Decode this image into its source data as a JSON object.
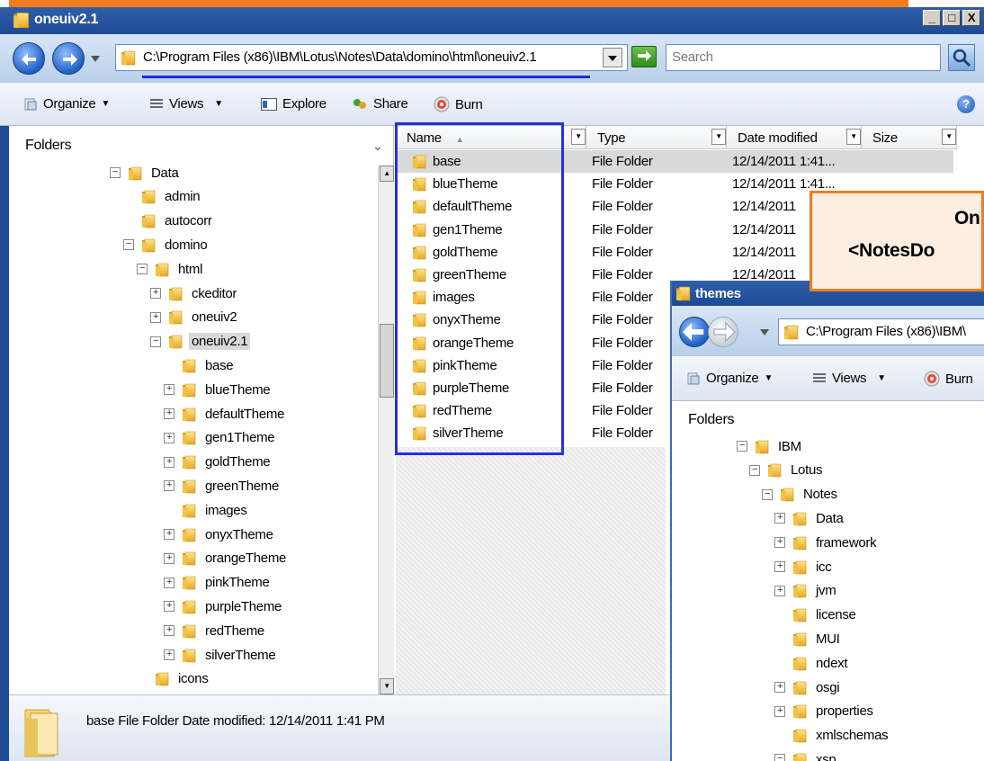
{
  "window": {
    "title": "oneuiv2.1",
    "address": "C:\\Program Files (x86)\\IBM\\Lotus\\Notes\\Data\\domino\\html\\oneuiv2.1",
    "search_placeholder": "Search",
    "controls": {
      "minimize": "_",
      "maximize": "□",
      "close": "X"
    }
  },
  "toolbar": {
    "organize": "Organize",
    "views": "Views",
    "explore": "Explore",
    "share": "Share",
    "burn": "Burn",
    "help": "?"
  },
  "tree": {
    "header": "Folders",
    "items": [
      {
        "label": "Data",
        "exp": "-"
      },
      {
        "label": "admin",
        "exp": ""
      },
      {
        "label": "autocorr",
        "exp": ""
      },
      {
        "label": "domino",
        "exp": "-"
      },
      {
        "label": "html",
        "exp": "-"
      },
      {
        "label": "ckeditor",
        "exp": "+"
      },
      {
        "label": "oneuiv2",
        "exp": "+"
      },
      {
        "label": "oneuiv2.1",
        "exp": "-",
        "selected": true
      },
      {
        "label": "base",
        "exp": ""
      },
      {
        "label": "blueTheme",
        "exp": "+"
      },
      {
        "label": "defaultTheme",
        "exp": "+"
      },
      {
        "label": "gen1Theme",
        "exp": "+"
      },
      {
        "label": "goldTheme",
        "exp": "+"
      },
      {
        "label": "greenTheme",
        "exp": "+"
      },
      {
        "label": "images",
        "exp": ""
      },
      {
        "label": "onyxTheme",
        "exp": "+"
      },
      {
        "label": "orangeTheme",
        "exp": "+"
      },
      {
        "label": "pinkTheme",
        "exp": "+"
      },
      {
        "label": "purpleTheme",
        "exp": "+"
      },
      {
        "label": "redTheme",
        "exp": "+"
      },
      {
        "label": "silverTheme",
        "exp": "+"
      },
      {
        "label": "icons",
        "exp": ""
      }
    ]
  },
  "list": {
    "columns": [
      "Name",
      "Type",
      "Date modified",
      "Size"
    ],
    "rows": [
      {
        "name": "base",
        "type": "File Folder",
        "date": "12/14/2011 1:41...",
        "selected": true
      },
      {
        "name": "blueTheme",
        "type": "File Folder",
        "date": "12/14/2011 1:41..."
      },
      {
        "name": "defaultTheme",
        "type": "File Folder",
        "date": "12/14/2011"
      },
      {
        "name": "gen1Theme",
        "type": "File Folder",
        "date": "12/14/2011"
      },
      {
        "name": "goldTheme",
        "type": "File Folder",
        "date": "12/14/2011"
      },
      {
        "name": "greenTheme",
        "type": "File Folder",
        "date": "12/14/2011"
      },
      {
        "name": "images",
        "type": "File Folder",
        "date": ""
      },
      {
        "name": "onyxTheme",
        "type": "File Folder",
        "date": ""
      },
      {
        "name": "orangeTheme",
        "type": "File Folder",
        "date": ""
      },
      {
        "name": "pinkTheme",
        "type": "File Folder",
        "date": ""
      },
      {
        "name": "purpleTheme",
        "type": "File Folder",
        "date": ""
      },
      {
        "name": "redTheme",
        "type": "File Folder",
        "date": ""
      },
      {
        "name": "silverTheme",
        "type": "File Folder",
        "date": ""
      }
    ]
  },
  "callout": {
    "line1": "On",
    "line2": "<NotesDo"
  },
  "window2": {
    "title": "themes",
    "address": "C:\\Program Files (x86)\\IBM\\",
    "toolbar": {
      "organize": "Organize",
      "views": "Views",
      "burn": "Burn"
    },
    "tree_header": "Folders",
    "tree": [
      {
        "label": "IBM",
        "exp": "-"
      },
      {
        "label": "Lotus",
        "exp": "-"
      },
      {
        "label": "Notes",
        "exp": "-"
      },
      {
        "label": "Data",
        "exp": "+"
      },
      {
        "label": "framework",
        "exp": "+"
      },
      {
        "label": "icc",
        "exp": "+"
      },
      {
        "label": "jvm",
        "exp": "+"
      },
      {
        "label": "license",
        "exp": ""
      },
      {
        "label": "MUI",
        "exp": ""
      },
      {
        "label": "ndext",
        "exp": ""
      },
      {
        "label": "osgi",
        "exp": "+"
      },
      {
        "label": "properties",
        "exp": "+"
      },
      {
        "label": "xmlschemas",
        "exp": ""
      },
      {
        "label": "xsp",
        "exp": "-"
      }
    ]
  },
  "status": {
    "text": "base File Folder Date modified: 12/14/2011 1:41 PM"
  },
  "colors": {
    "accent_orange": "#f37c21",
    "highlight_blue": "#2530e0",
    "title_blue": "#1d4a95"
  }
}
